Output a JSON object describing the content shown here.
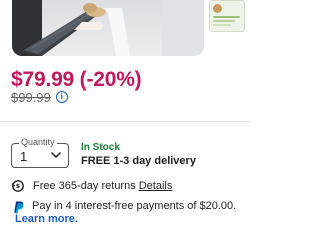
{
  "price": {
    "current": "$79.99 (-20%)",
    "was": "$99.99"
  },
  "quantity": {
    "label": "Quantity",
    "value": "1"
  },
  "availability": {
    "stock": "In Stock",
    "delivery": "FREE 1-3 day delivery"
  },
  "returns": {
    "text": "Free 365-day returns",
    "link": "Details"
  },
  "paypal": {
    "text": "Pay in 4 interest-free payments of $20.00.",
    "link": "Learn more."
  },
  "colors": {
    "price": "#c1185b",
    "stock": "#1a7f37",
    "link": "#1f5fbf"
  },
  "icons": [
    "info-icon",
    "chevron-down-icon",
    "returns-icon",
    "paypal-icon"
  ]
}
